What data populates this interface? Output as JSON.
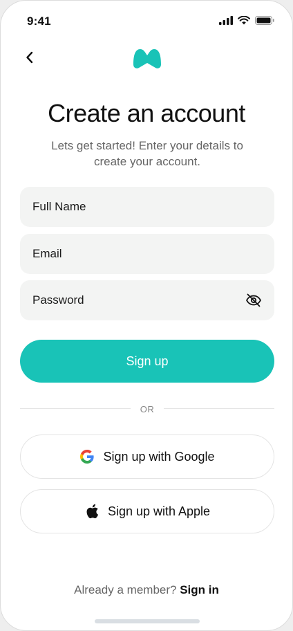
{
  "status_bar": {
    "time": "9:41",
    "icons": [
      "signal-icon",
      "wifi-icon",
      "battery-icon"
    ]
  },
  "header": {
    "back_icon": "chevron-left-icon",
    "logo": "brand-logo"
  },
  "title": "Create an account",
  "subtitle": "Lets get started! Enter your details to create your account.",
  "form": {
    "full_name": {
      "placeholder": "Full Name",
      "value": ""
    },
    "email": {
      "placeholder": "Email",
      "value": ""
    },
    "password": {
      "placeholder": "Password",
      "value": "",
      "toggle_icon": "eye-off-icon"
    },
    "submit_label": "Sign up"
  },
  "divider_text": "OR",
  "social": {
    "google_label": "Sign up with Google",
    "google_icon": "google-icon",
    "apple_label": "Sign up with Apple",
    "apple_icon": "apple-icon"
  },
  "footer": {
    "prompt": "Already a member?",
    "link": "Sign in"
  },
  "colors": {
    "accent": "#19c3b7",
    "field_bg": "#f3f4f3",
    "muted_text": "#666666"
  }
}
